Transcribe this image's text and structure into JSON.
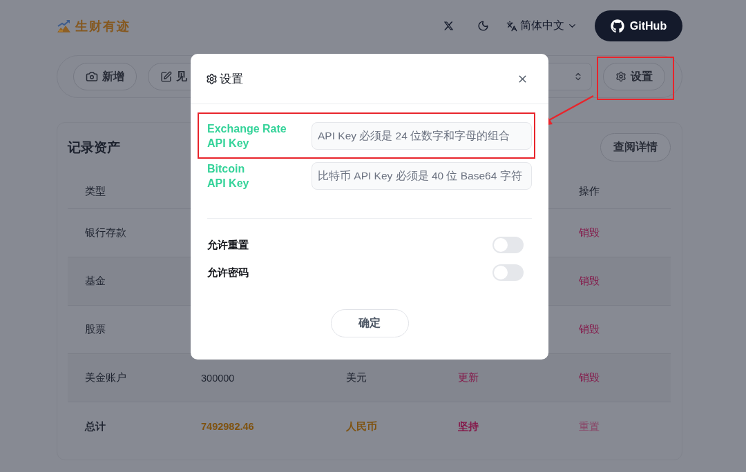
{
  "header": {
    "logo": "生财有迹",
    "language": "简体中文",
    "github_button": "GitHub"
  },
  "toolbar": {
    "buttons": [
      "新增",
      "见"
    ],
    "settings_button": {
      "label": "设置",
      "highlighted": true
    }
  },
  "table": {
    "title": "记录资产",
    "details_button": "查阅详情",
    "columns": {
      "column_1": "类型",
      "column_5": "操作"
    },
    "rows": [
      {
        "kind": "entry",
        "column_1": "银行存款",
        "column_5": {
          "label": "销毁",
          "disabled": false
        }
      },
      {
        "kind": "entry",
        "column_1": "基金",
        "column_5": {
          "label": "销毁",
          "disabled": false
        }
      },
      {
        "kind": "entry",
        "column_1": "股票",
        "column_5": {
          "label": "销毁",
          "disabled": false
        }
      },
      {
        "kind": "entry",
        "column_1": "美金账户",
        "column_2": "300000",
        "column_3": "美元",
        "column_4": "更新",
        "column_5": {
          "label": "销毁",
          "disabled": false
        }
      },
      {
        "kind": "total",
        "column_1": "总计",
        "column_2": "7492982.46",
        "column_3": "人民币",
        "column_4": "坚持",
        "column_5": {
          "label": "重置",
          "disabled": true
        }
      }
    ]
  },
  "modal": {
    "title": "设置",
    "fields": [
      {
        "label": "Exchange Rate\nAPI Key",
        "placeholder": "API Key 必须是 24 位数字和字母的组合",
        "highlighted": true
      },
      {
        "label": "Bitcoin\nAPI Key",
        "placeholder": "比特币 API Key 必须是 40 位 Base64 字符",
        "highlighted": false
      }
    ],
    "toggles": [
      {
        "label": "允许重置",
        "on": false
      },
      {
        "label": "允许密码",
        "on": false
      }
    ],
    "confirm_button": "确定"
  }
}
